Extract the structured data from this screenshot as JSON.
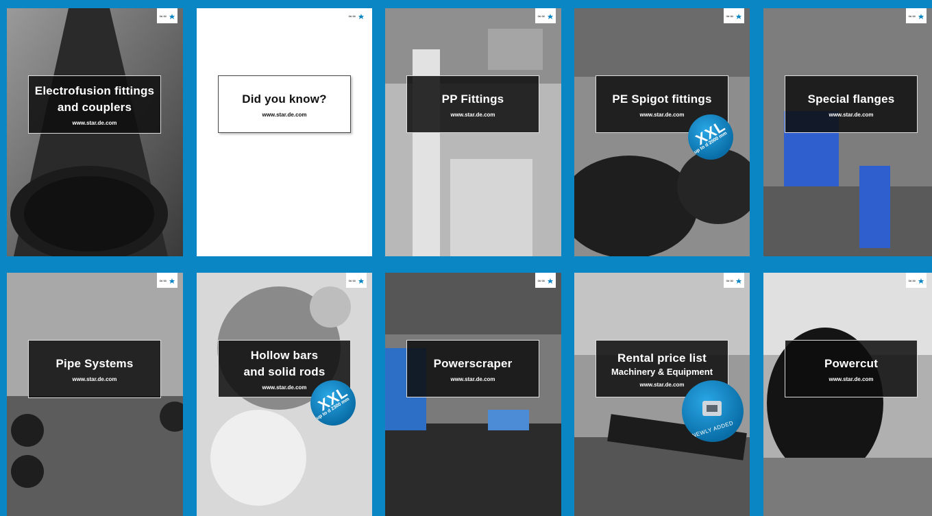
{
  "colors": {
    "background": "#0a86c5",
    "badge": "#0f82c4"
  },
  "cards": [
    {
      "title": "Electrofusion fittings\nand couplers",
      "url": "www.star.de.com"
    },
    {
      "title": "Did you know?",
      "url": "www.star.de.com"
    },
    {
      "title": "PP Fittings",
      "url": "www.star.de.com"
    },
    {
      "title": "PE Spigot fittings",
      "url": "www.star.de.com",
      "badge": {
        "main": "XXL",
        "sub": "up to d 2000 mm"
      }
    },
    {
      "title": "Special flanges",
      "url": "www.star.de.com"
    },
    {
      "title": "Pipe Systems",
      "url": "www.star.de.com"
    },
    {
      "title": "Hollow bars\nand solid rods",
      "url": "www.star.de.com",
      "badge": {
        "main": "XXL",
        "sub": "up to d 2300 mm"
      }
    },
    {
      "title": "Powerscraper",
      "url": "www.star.de.com"
    },
    {
      "title": "Rental price list",
      "subtitle": "Machinery & Equipment",
      "url": "www.star.de.com",
      "badge": {
        "main": "NEWLY ADDED"
      }
    },
    {
      "title": "Powercut",
      "url": "www.star.de.com"
    }
  ]
}
